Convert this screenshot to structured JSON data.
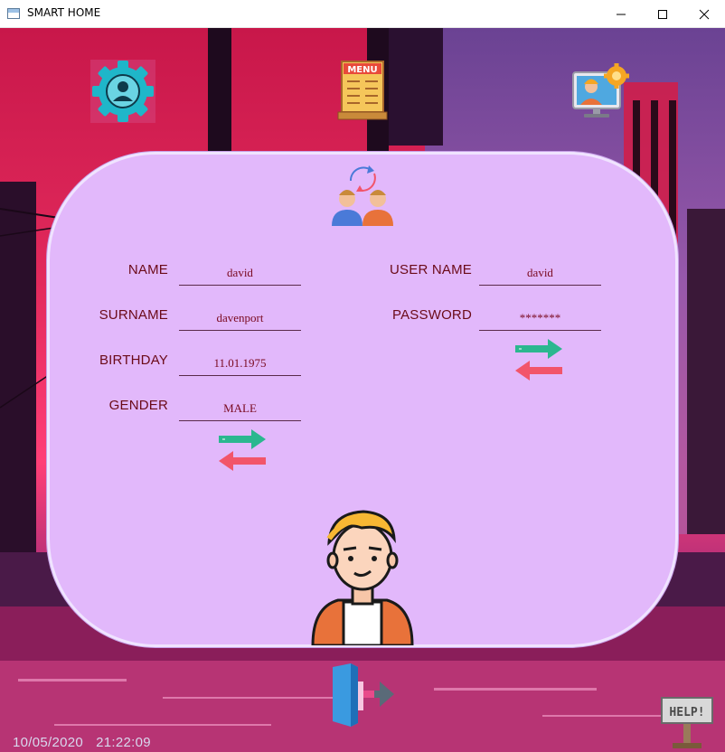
{
  "window": {
    "title": "SMART HOME"
  },
  "toolbar": {
    "profile_settings_icon": "user-gear-icon",
    "menu_icon": "menu-board-icon",
    "menu_icon_text": "MENU",
    "support_icon": "engineer-monitor-icon"
  },
  "form": {
    "left": {
      "name_label": "NAME",
      "name_value": "david",
      "surname_label": "SURNAME",
      "surname_value": "davenport",
      "birthday_label": "BIRTHDAY",
      "birthday_value": "11.01.1975",
      "gender_label": "GENDER",
      "gender_value": "MALE"
    },
    "right": {
      "username_label": "USER NAME",
      "username_value": "david",
      "password_label": "PASSWORD",
      "password_value": "*******"
    }
  },
  "footer": {
    "date": "10/05/2020",
    "time": "21:22:09",
    "help_label": "HELP!"
  },
  "colors": {
    "card": "#e2b8fb",
    "label": "#6b0a18",
    "arrow_green": "#2bb78f",
    "arrow_red": "#f2556a"
  }
}
